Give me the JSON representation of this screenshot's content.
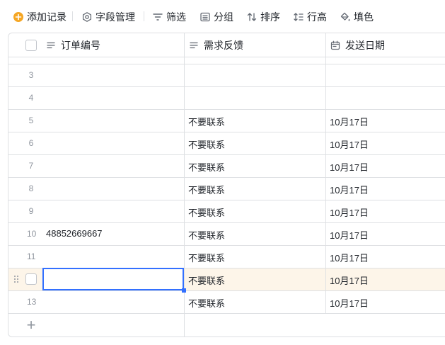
{
  "toolbar": {
    "add_record": "添加记录",
    "field_manage": "字段管理",
    "filter": "筛选",
    "group": "分组",
    "sort": "排序",
    "row_height": "行高",
    "fill_color": "填色"
  },
  "table": {
    "columns": [
      {
        "label": "订单编号",
        "icon": "text-lines-icon"
      },
      {
        "label": "需求反馈",
        "icon": "text-lines-icon"
      },
      {
        "label": "发送日期",
        "icon": "calendar-icon"
      }
    ],
    "rows": [
      {
        "num": "3",
        "order": "",
        "feedback": "",
        "date": ""
      },
      {
        "num": "4",
        "order": "",
        "feedback": "",
        "date": ""
      },
      {
        "num": "5",
        "order": "",
        "feedback": "不要联系",
        "date": "10月17日"
      },
      {
        "num": "6",
        "order": "",
        "feedback": "不要联系",
        "date": "10月17日"
      },
      {
        "num": "7",
        "order": "",
        "feedback": "不要联系",
        "date": "10月17日"
      },
      {
        "num": "8",
        "order": "",
        "feedback": "不要联系",
        "date": "10月17日"
      },
      {
        "num": "9",
        "order": "",
        "feedback": "不要联系",
        "date": "10月17日"
      },
      {
        "num": "10",
        "order": "48852669667",
        "feedback": "不要联系",
        "date": "10月17日"
      },
      {
        "num": "11",
        "order": "",
        "feedback": "不要联系",
        "date": "10月17日"
      },
      {
        "num": "",
        "order": "",
        "feedback": "不要联系",
        "date": "10月17日"
      },
      {
        "num": "13",
        "order": "",
        "feedback": "不要联系",
        "date": "10月17日"
      }
    ],
    "add_row_symbol": "+"
  },
  "colors": {
    "accent": "#f5a623",
    "selection": "#3370ff",
    "active_row_bg": "#fdf5e9",
    "grid": "#dee0e3"
  }
}
